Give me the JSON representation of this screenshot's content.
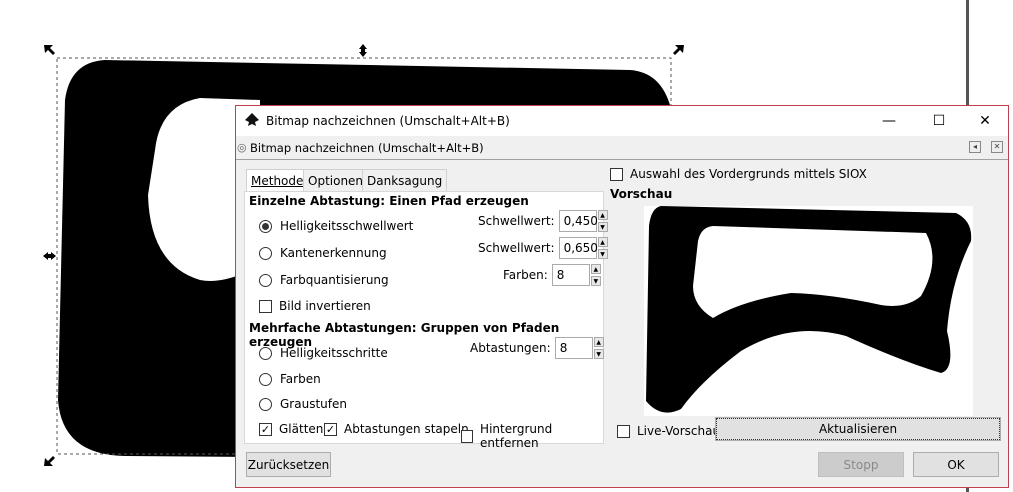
{
  "window": {
    "title": "Bitmap nachzeichnen (Umschalt+Alt+B)",
    "minimize": "—",
    "maximize": "☐",
    "close": "✕"
  },
  "dock": {
    "title": "Bitmap nachzeichnen (Umschalt+Alt+B)"
  },
  "tabs": [
    {
      "label": "Methode",
      "active": true
    },
    {
      "label": "Optionen"
    },
    {
      "label": "Danksagung"
    }
  ],
  "single": {
    "heading": "Einzelne Abtastung: Einen Pfad erzeugen",
    "brightness": {
      "label": "Helligkeitsschwellwert",
      "selected": true,
      "spin_label": "Schwellwert:",
      "value": "0,450"
    },
    "edge": {
      "label": "Kantenerkennung",
      "selected": false,
      "spin_label": "Schwellwert:",
      "value": "0,650"
    },
    "quant": {
      "label": "Farbquantisierung",
      "selected": false,
      "spin_label": "Farben:",
      "value": "8"
    },
    "invert": {
      "label": "Bild invertieren",
      "checked": false
    }
  },
  "multi": {
    "heading": "Mehrfache Abtastungen: Gruppen von Pfaden erzeugen",
    "steps": {
      "label": "Helligkeitsschritte",
      "spin_label": "Abtastungen:",
      "value": "8"
    },
    "colors": {
      "label": "Farben"
    },
    "gray": {
      "label": "Graustufen"
    },
    "smooth": {
      "label": "Glätten",
      "checked": true
    },
    "stack": {
      "label": "Abtastungen stapeln",
      "checked": true
    },
    "remove_bg": {
      "label": "Hintergrund entfernen",
      "checked": false
    }
  },
  "siox": {
    "label": "Auswahl des Vordergrunds mittels SIOX",
    "checked": false
  },
  "preview": {
    "heading": "Vorschau",
    "live_label": "Live-Vorschau",
    "live_checked": false,
    "update_label": "Aktualisieren"
  },
  "buttons": {
    "reset": "Zurücksetzen",
    "stop": "Stopp",
    "ok": "OK"
  }
}
